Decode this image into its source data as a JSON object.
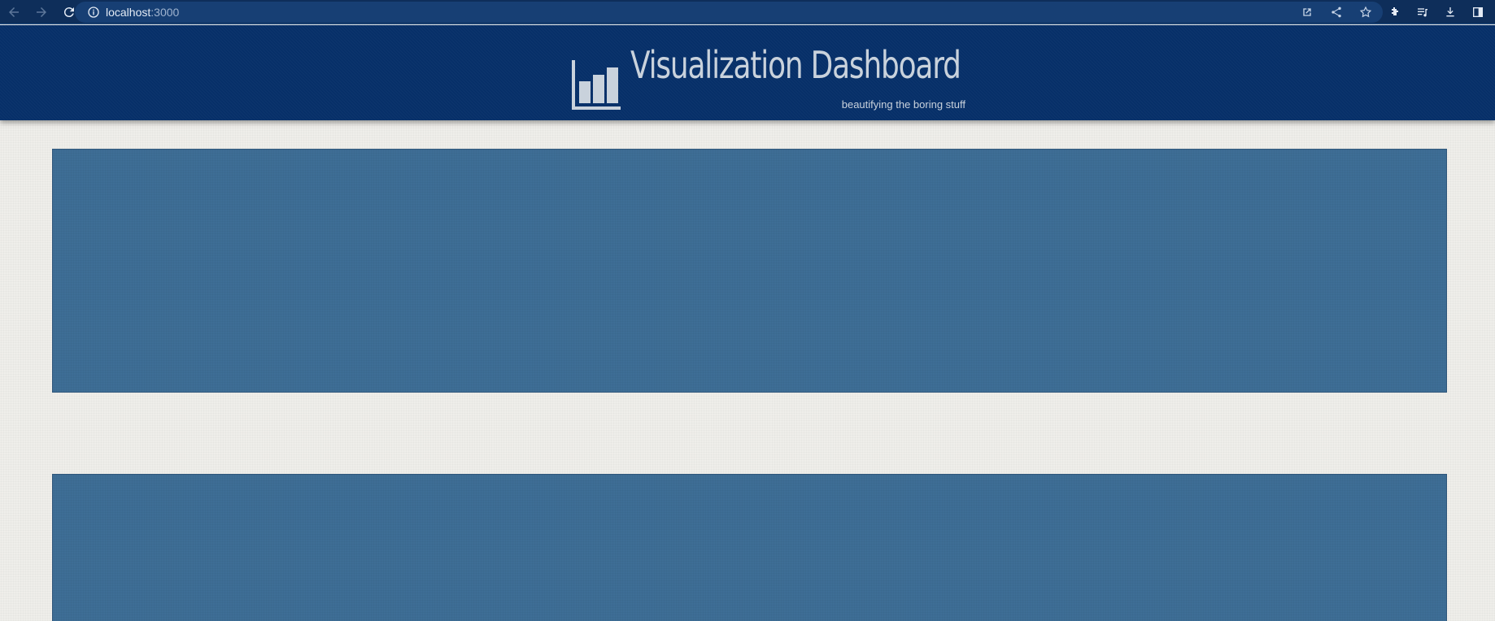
{
  "browser": {
    "url_host": "localhost",
    "url_port": ":3000"
  },
  "header": {
    "title": "Visualization Dashboard",
    "subtitle": "beautifying the boring stuff",
    "logo_icon": "bar-chart-icon"
  },
  "colors": {
    "header_bg": "#062f68",
    "panel_bg": "#3e6e96",
    "page_bg": "#efeeea",
    "title_text": "#c9d2dc"
  }
}
